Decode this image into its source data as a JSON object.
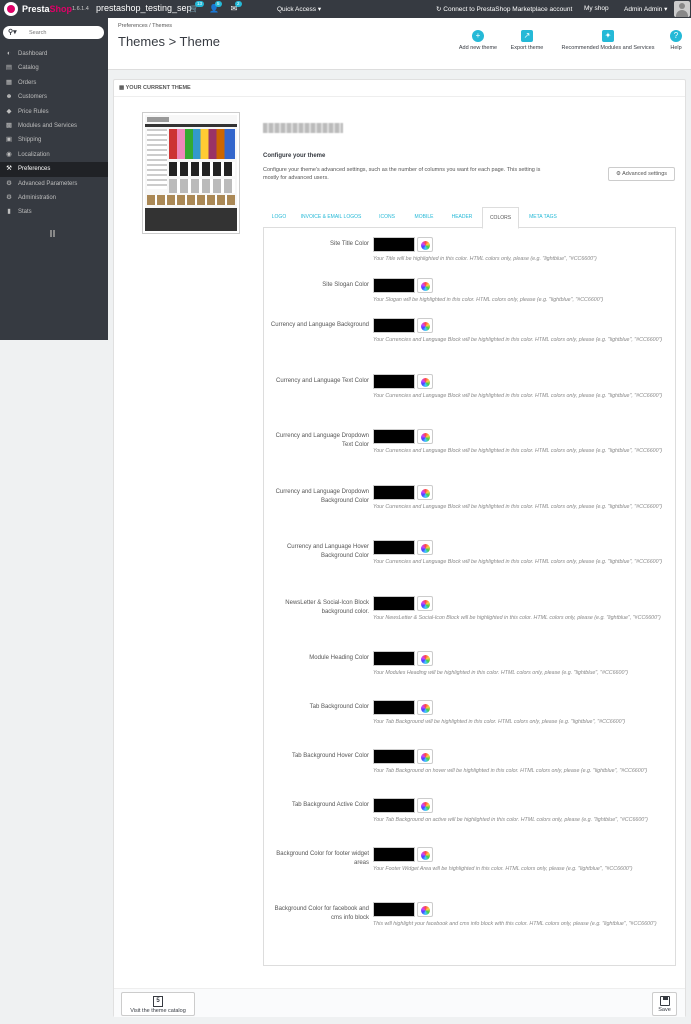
{
  "topbar": {
    "brand": "PrestaShop",
    "brand_part1": "Presta",
    "brand_part2": "Shop",
    "version": "1.6.1.4",
    "shop_name": "prestashop_testing_sep",
    "cart_count": "13",
    "customers_count": "5",
    "messages_count": "2",
    "quick_access": "Quick Access ▾",
    "connect": "Connect to PrestaShop Marketplace account",
    "my_shop": "My shop",
    "admin": "Admin Admin ▾"
  },
  "sidebar": {
    "search_placeholder": "Search",
    "items": [
      {
        "label": "Dashboard",
        "icon": "dashboard-icon"
      },
      {
        "label": "Catalog",
        "icon": "catalog-icon"
      },
      {
        "label": "Orders",
        "icon": "orders-icon"
      },
      {
        "label": "Customers",
        "icon": "customers-icon"
      },
      {
        "label": "Price Rules",
        "icon": "price-rules-icon"
      },
      {
        "label": "Modules and Services",
        "icon": "modules-icon"
      },
      {
        "label": "Shipping",
        "icon": "shipping-icon"
      },
      {
        "label": "Localization",
        "icon": "localization-icon"
      },
      {
        "label": "Preferences",
        "icon": "preferences-icon",
        "active": true
      },
      {
        "label": "Advanced Parameters",
        "icon": "advanced-parameters-icon"
      },
      {
        "label": "Administration",
        "icon": "administration-icon"
      },
      {
        "label": "Stats",
        "icon": "stats-icon"
      }
    ]
  },
  "header": {
    "breadcrumb": "Preferences  /  Themes",
    "title": "Themes > Theme",
    "toolbar": [
      {
        "label": "Add new theme",
        "icon": "add-icon"
      },
      {
        "label": "Export theme",
        "icon": "export-icon"
      },
      {
        "label": "Recommended Modules and Services",
        "icon": "puzzle-icon"
      },
      {
        "label": "Help",
        "icon": "help-icon"
      }
    ]
  },
  "panel": {
    "heading": "YOUR CURRENT THEME",
    "configure_title": "Configure your theme",
    "configure_desc": "Configure your theme's advanced settings, such as the number of columns you want for each page. This setting is mostly for advanced users.",
    "advanced_settings": "Advanced settings",
    "tabs": [
      "LOGO",
      "INVOICE & EMAIL LOGOS",
      "ICONS",
      "MOBILE",
      "HEADER",
      "COLORS",
      "META TAGS"
    ],
    "active_tab": "COLORS",
    "swatch_color": "#000000",
    "fields": [
      {
        "label": "Site Title Color",
        "help": "Your Title will be highlighted in this color. HTML colors only, please (e.g. \"lightblue\", \"#CC6600\")"
      },
      {
        "label": "Site Slogan Color",
        "help": "Your Slogan will be highlighted in this color. HTML colors only, please (e.g. \"lightblue\", \"#CC6600\")"
      },
      {
        "label": "Currency and Language Background",
        "help": "Your Currencies and Language Block will be highlighted in this color. HTML colors only, please (e.g. \"lightblue\", \"#CC6600\")"
      },
      {
        "label": "Currency and Language Text Color",
        "help": "Your Currencies and Language Block will be highlighted in this color. HTML colors only, please (e.g. \"lightblue\", \"#CC6600\")"
      },
      {
        "label": "Currency and Language Dropdown Text Color",
        "help": "Your Currencies and Language Block will be highlighted in this color. HTML colors only, please (e.g. \"lightblue\", \"#CC6600\")"
      },
      {
        "label": "Currency and Language Dropdown Background Color",
        "help": "Your Currencies and Language Block will be highlighted in this color. HTML colors only, please (e.g. \"lightblue\", \"#CC6600\")"
      },
      {
        "label": "Currency and Language Hover Background Color",
        "help": "Your Currencies and Language Block will be highlighted in this color. HTML colors only, please (e.g. \"lightblue\", \"#CC6600\")"
      },
      {
        "label": "NewsLetter & Social-Icon Block background color.",
        "help": "Your NewsLetter & Social-Icon Block will be highlighted in this color. HTML colors only, please (e.g. \"lightblue\", \"#CC6600\")"
      },
      {
        "label": "Module Heading Color",
        "help": "Your Modules Heading will be highlighted in this color. HTML colors only, please (e.g. \"lightblue\", \"#CC6600\")"
      },
      {
        "label": "Tab Background Color",
        "help": "Your Tab Background will be highlighted in this color. HTML colors only, please (e.g. \"lightblue\", \"#CC6600\")"
      },
      {
        "label": "Tab Background Hover Color",
        "help": "Your Tab Background on hover will be highlighted in this color. HTML colors only, please (e.g. \"lightblue\", \"#CC6600\")"
      },
      {
        "label": "Tab Background Active Color",
        "help": "Your Tab Background on active will be highlighted in this color. HTML colors only, please (e.g. \"lightblue\", \"#CC6600\")"
      },
      {
        "label": "Background Color for footer widget areas",
        "help": "Your Footer Widget Area will be highlighted in this color. HTML colors only, please (e.g. \"lightblue\", \"#CC6600\")"
      },
      {
        "label": "Background Color for facebook and cms info block",
        "help": "This will highlight your facebook and cms info block with this color. HTML colors only, please (e.g. \"lightblue\", \"#CC6600\")"
      }
    ]
  },
  "footer": {
    "catalog_button": "Visit the theme catalog",
    "save_button": "Save"
  }
}
